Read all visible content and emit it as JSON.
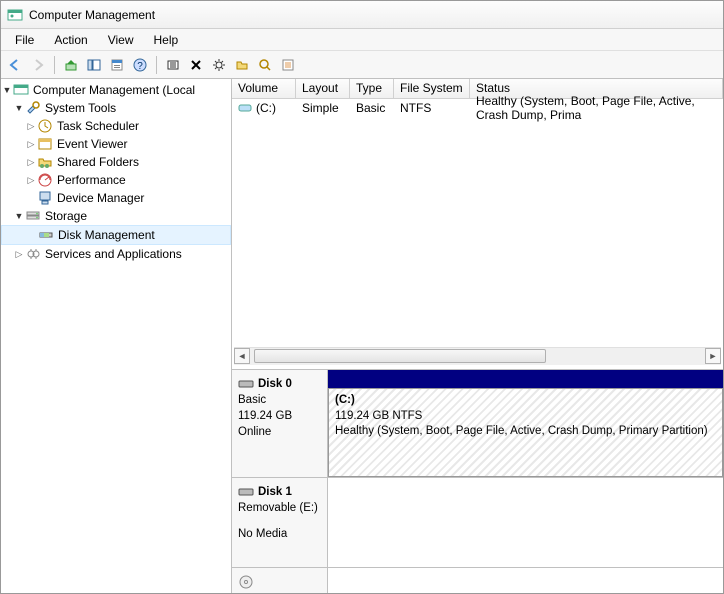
{
  "window": {
    "title": "Computer Management"
  },
  "menu": {
    "file": "File",
    "action": "Action",
    "view": "View",
    "help": "Help"
  },
  "tree": {
    "root": "Computer Management (Local",
    "system_tools": "System Tools",
    "task_scheduler": "Task Scheduler",
    "event_viewer": "Event Viewer",
    "shared_folders": "Shared Folders",
    "performance": "Performance",
    "device_manager": "Device Manager",
    "storage": "Storage",
    "disk_management": "Disk Management",
    "services_apps": "Services and Applications"
  },
  "columns": {
    "volume": "Volume",
    "layout": "Layout",
    "type": "Type",
    "fs": "File System",
    "status": "Status"
  },
  "volumes": {
    "c": {
      "name": "(C:)",
      "layout": "Simple",
      "type": "Basic",
      "fs": "NTFS",
      "status": "Healthy (System, Boot, Page File, Active, Crash Dump, Prima"
    }
  },
  "disks": {
    "d0": {
      "name": "Disk 0",
      "type": "Basic",
      "size": "119.24 GB",
      "state": "Online",
      "vol_name": "(C:)",
      "vol_size": "119.24 GB NTFS",
      "vol_status": "Healthy (System, Boot, Page File, Active, Crash Dump, Primary Partition)"
    },
    "d1": {
      "name": "Disk 1",
      "type": "Removable (E:)",
      "state": "No Media"
    }
  }
}
